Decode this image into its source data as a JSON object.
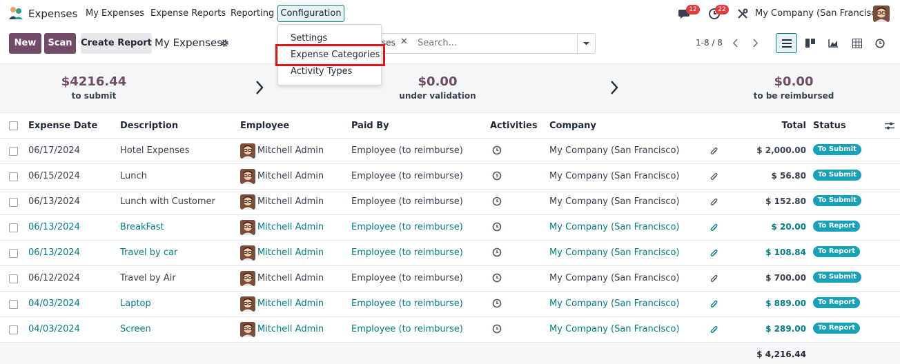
{
  "app": {
    "name": "Expenses",
    "logo_icon": "expenses-app-icon"
  },
  "top_menu": [
    "My Expenses",
    "Expense Reports",
    "Reporting",
    "Configuration"
  ],
  "systray": {
    "messages_count": "12",
    "activities_count": "22",
    "company": "My Company (San Francisco)"
  },
  "control": {
    "new_label": "New",
    "scan_label": "Scan",
    "create_report_label": "Create Report",
    "title": "My Expenses",
    "facet_text": "ses",
    "search_placeholder": "Search...",
    "pager": "1-8 / 8"
  },
  "config_dropdown": [
    "Settings",
    "Expense Categories",
    "Activity Types"
  ],
  "summary": [
    {
      "amount": "$4216.44",
      "label": "to submit",
      "color": "#714b67"
    },
    {
      "amount": "$0.00",
      "label": "under validation",
      "color": "#714b67"
    },
    {
      "amount": "$0.00",
      "label": "to be reimbursed",
      "color": "#714b67"
    }
  ],
  "columns": [
    "Expense Date",
    "Description",
    "Employee",
    "Paid By",
    "Activities",
    "Company",
    "Total",
    "Status"
  ],
  "rows": [
    {
      "date": "06/17/2024",
      "description": "Hotel Expenses",
      "employee": "Mitchell Admin",
      "paid_by": "Employee (to reimburse)",
      "company": "My Company (San Francisco)",
      "total": "$ 2,000.00",
      "status": "To Submit",
      "style": "dark"
    },
    {
      "date": "06/15/2024",
      "description": "Lunch",
      "employee": "Mitchell Admin",
      "paid_by": "Employee (to reimburse)",
      "company": "My Company (San Francisco)",
      "total": "$ 56.80",
      "status": "To Submit",
      "style": "dark"
    },
    {
      "date": "06/13/2024",
      "description": "Lunch with Customer",
      "employee": "Mitchell Admin",
      "paid_by": "Employee (to reimburse)",
      "company": "My Company (San Francisco)",
      "total": "$ 152.80",
      "status": "To Submit",
      "style": "dark"
    },
    {
      "date": "06/13/2024",
      "description": "BreakFast",
      "employee": "Mitchell Admin",
      "paid_by": "Employee (to reimburse)",
      "company": "My Company (San Francisco)",
      "total": "$ 20.00",
      "status": "To Report",
      "style": "link"
    },
    {
      "date": "06/13/2024",
      "description": "Travel by car",
      "employee": "Mitchell Admin",
      "paid_by": "Employee (to reimburse)",
      "company": "My Company (San Francisco)",
      "total": "$ 108.84",
      "status": "To Report",
      "style": "link"
    },
    {
      "date": "06/12/2024",
      "description": "Travel by Air",
      "employee": "Mitchell Admin",
      "paid_by": "Employee (to reimburse)",
      "company": "My Company (San Francisco)",
      "total": "$ 700.00",
      "status": "To Submit",
      "style": "dark"
    },
    {
      "date": "04/03/2024",
      "description": "Laptop",
      "employee": "Mitchell Admin",
      "paid_by": "Employee (to reimburse)",
      "company": "My Company (San Francisco)",
      "total": "$ 889.00",
      "status": "To Report",
      "style": "link"
    },
    {
      "date": "04/03/2024",
      "description": "Screen",
      "employee": "Mitchell Admin",
      "paid_by": "Employee (to reimburse)",
      "company": "My Company (San Francisco)",
      "total": "$ 289.00",
      "status": "To Report",
      "style": "link"
    }
  ],
  "grand_total": "$ 4,216.44",
  "colors": {
    "brand": "#714b67",
    "accent": "#017e84",
    "badge": "#17a2b8",
    "highlight": "#e0141e"
  }
}
